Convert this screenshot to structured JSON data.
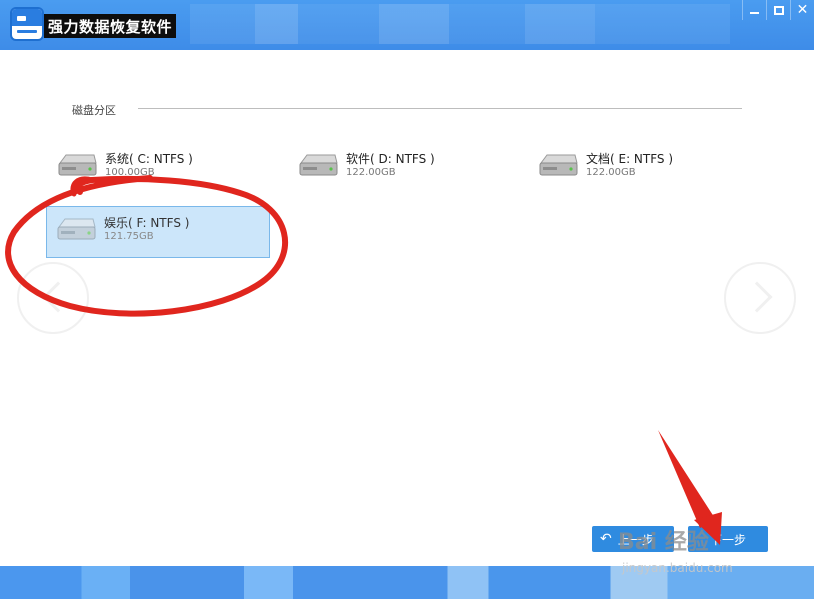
{
  "window": {
    "title": "强力数据恢复软件",
    "controls": {
      "minimize": "minimize",
      "maximize": "maximize",
      "close": "✕"
    }
  },
  "section": {
    "label": "磁盘分区"
  },
  "drives": [
    {
      "name": "系统( C: NTFS )",
      "size": "100.00GB",
      "selected": false
    },
    {
      "name": "软件( D: NTFS )",
      "size": "122.00GB",
      "selected": false
    },
    {
      "name": "文档( E: NTFS )",
      "size": "122.00GB",
      "selected": false
    },
    {
      "name": "娱乐( F: NTFS )",
      "size": "121.75GB",
      "selected": true
    }
  ],
  "buttons": {
    "back_label": "上一步",
    "next_label": "下一步"
  },
  "watermark": {
    "brand": "Bai 经验",
    "url": "jingyan.baidu.com"
  },
  "annotation_color": "#e0261e",
  "accent_color": "#3e8ce8"
}
